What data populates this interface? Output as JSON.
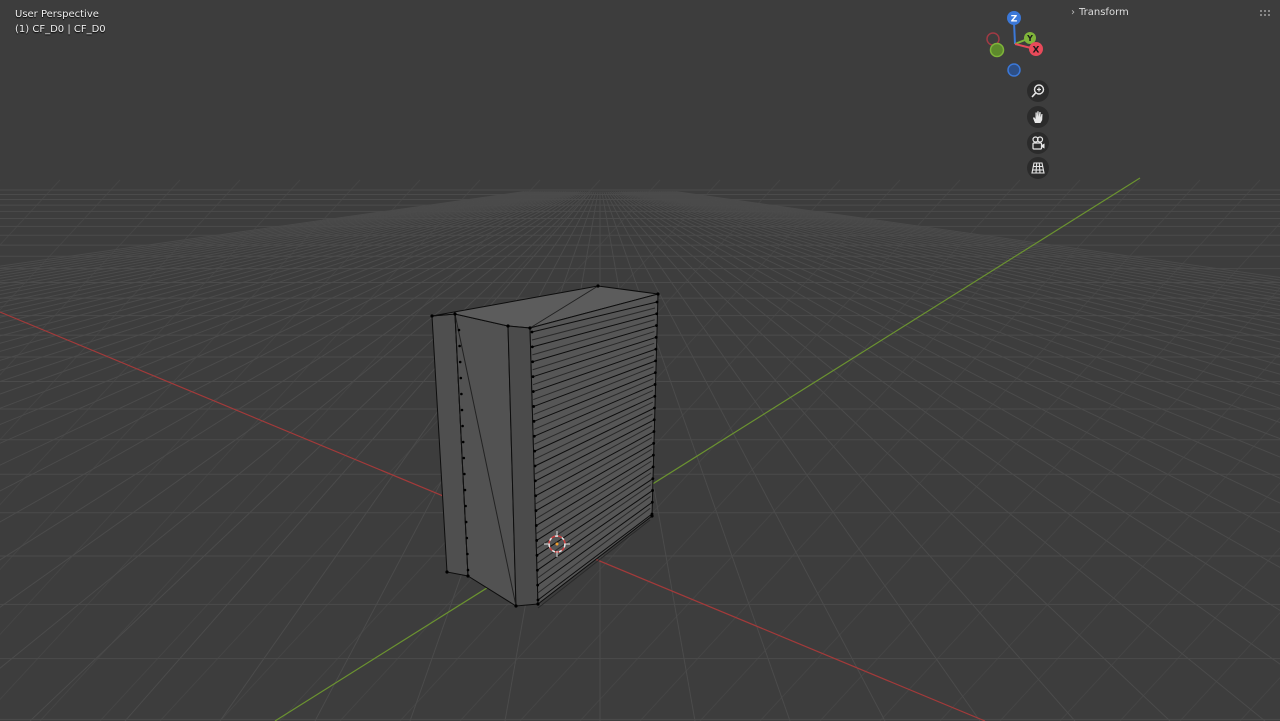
{
  "viewport": {
    "perspective_label": "User Perspective",
    "object_label": "(1) CF_D0 | CF_D0",
    "background_color": "#3d3d3d",
    "grid_color": "#4a4a4a",
    "x_axis_color": "#b03a3a",
    "y_axis_color": "#6c9a2a"
  },
  "gizmo": {
    "axes": [
      {
        "label": "Z",
        "color": "#3b78d8"
      },
      {
        "label": "Y",
        "color": "#7fb43a"
      },
      {
        "label": "X",
        "color": "#e84a5a"
      }
    ]
  },
  "view_tools": [
    {
      "name": "zoom-icon"
    },
    {
      "name": "pan-hand-icon"
    },
    {
      "name": "camera-view-icon"
    },
    {
      "name": "grid-ortho-icon"
    }
  ],
  "sidebar": {
    "transform_label": "Transform"
  }
}
